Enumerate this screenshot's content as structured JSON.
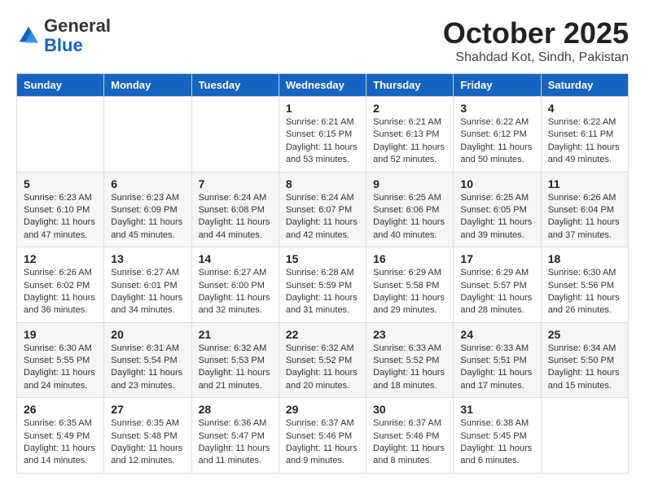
{
  "logo": {
    "general": "General",
    "blue": "Blue"
  },
  "header": {
    "month": "October 2025",
    "location": "Shahdad Kot, Sindh, Pakistan"
  },
  "weekdays": [
    "Sunday",
    "Monday",
    "Tuesday",
    "Wednesday",
    "Thursday",
    "Friday",
    "Saturday"
  ],
  "weeks": [
    [
      {
        "day": "",
        "content": ""
      },
      {
        "day": "",
        "content": ""
      },
      {
        "day": "",
        "content": ""
      },
      {
        "day": "1",
        "content": "Sunrise: 6:21 AM\nSunset: 6:15 PM\nDaylight: 11 hours\nand 53 minutes."
      },
      {
        "day": "2",
        "content": "Sunrise: 6:21 AM\nSunset: 6:13 PM\nDaylight: 11 hours\nand 52 minutes."
      },
      {
        "day": "3",
        "content": "Sunrise: 6:22 AM\nSunset: 6:12 PM\nDaylight: 11 hours\nand 50 minutes."
      },
      {
        "day": "4",
        "content": "Sunrise: 6:22 AM\nSunset: 6:11 PM\nDaylight: 11 hours\nand 49 minutes."
      }
    ],
    [
      {
        "day": "5",
        "content": "Sunrise: 6:23 AM\nSunset: 6:10 PM\nDaylight: 11 hours\nand 47 minutes."
      },
      {
        "day": "6",
        "content": "Sunrise: 6:23 AM\nSunset: 6:09 PM\nDaylight: 11 hours\nand 45 minutes."
      },
      {
        "day": "7",
        "content": "Sunrise: 6:24 AM\nSunset: 6:08 PM\nDaylight: 11 hours\nand 44 minutes."
      },
      {
        "day": "8",
        "content": "Sunrise: 6:24 AM\nSunset: 6:07 PM\nDaylight: 11 hours\nand 42 minutes."
      },
      {
        "day": "9",
        "content": "Sunrise: 6:25 AM\nSunset: 6:06 PM\nDaylight: 11 hours\nand 40 minutes."
      },
      {
        "day": "10",
        "content": "Sunrise: 6:25 AM\nSunset: 6:05 PM\nDaylight: 11 hours\nand 39 minutes."
      },
      {
        "day": "11",
        "content": "Sunrise: 6:26 AM\nSunset: 6:04 PM\nDaylight: 11 hours\nand 37 minutes."
      }
    ],
    [
      {
        "day": "12",
        "content": "Sunrise: 6:26 AM\nSunset: 6:02 PM\nDaylight: 11 hours\nand 36 minutes."
      },
      {
        "day": "13",
        "content": "Sunrise: 6:27 AM\nSunset: 6:01 PM\nDaylight: 11 hours\nand 34 minutes."
      },
      {
        "day": "14",
        "content": "Sunrise: 6:27 AM\nSunset: 6:00 PM\nDaylight: 11 hours\nand 32 minutes."
      },
      {
        "day": "15",
        "content": "Sunrise: 6:28 AM\nSunset: 5:59 PM\nDaylight: 11 hours\nand 31 minutes."
      },
      {
        "day": "16",
        "content": "Sunrise: 6:29 AM\nSunset: 5:58 PM\nDaylight: 11 hours\nand 29 minutes."
      },
      {
        "day": "17",
        "content": "Sunrise: 6:29 AM\nSunset: 5:57 PM\nDaylight: 11 hours\nand 28 minutes."
      },
      {
        "day": "18",
        "content": "Sunrise: 6:30 AM\nSunset: 5:56 PM\nDaylight: 11 hours\nand 26 minutes."
      }
    ],
    [
      {
        "day": "19",
        "content": "Sunrise: 6:30 AM\nSunset: 5:55 PM\nDaylight: 11 hours\nand 24 minutes."
      },
      {
        "day": "20",
        "content": "Sunrise: 6:31 AM\nSunset: 5:54 PM\nDaylight: 11 hours\nand 23 minutes."
      },
      {
        "day": "21",
        "content": "Sunrise: 6:32 AM\nSunset: 5:53 PM\nDaylight: 11 hours\nand 21 minutes."
      },
      {
        "day": "22",
        "content": "Sunrise: 6:32 AM\nSunset: 5:52 PM\nDaylight: 11 hours\nand 20 minutes."
      },
      {
        "day": "23",
        "content": "Sunrise: 6:33 AM\nSunset: 5:52 PM\nDaylight: 11 hours\nand 18 minutes."
      },
      {
        "day": "24",
        "content": "Sunrise: 6:33 AM\nSunset: 5:51 PM\nDaylight: 11 hours\nand 17 minutes."
      },
      {
        "day": "25",
        "content": "Sunrise: 6:34 AM\nSunset: 5:50 PM\nDaylight: 11 hours\nand 15 minutes."
      }
    ],
    [
      {
        "day": "26",
        "content": "Sunrise: 6:35 AM\nSunset: 5:49 PM\nDaylight: 11 hours\nand 14 minutes."
      },
      {
        "day": "27",
        "content": "Sunrise: 6:35 AM\nSunset: 5:48 PM\nDaylight: 11 hours\nand 12 minutes."
      },
      {
        "day": "28",
        "content": "Sunrise: 6:36 AM\nSunset: 5:47 PM\nDaylight: 11 hours\nand 11 minutes."
      },
      {
        "day": "29",
        "content": "Sunrise: 6:37 AM\nSunset: 5:46 PM\nDaylight: 11 hours\nand 9 minutes."
      },
      {
        "day": "30",
        "content": "Sunrise: 6:37 AM\nSunset: 5:46 PM\nDaylight: 11 hours\nand 8 minutes."
      },
      {
        "day": "31",
        "content": "Sunrise: 6:38 AM\nSunset: 5:45 PM\nDaylight: 11 hours\nand 6 minutes."
      },
      {
        "day": "",
        "content": ""
      }
    ]
  ]
}
